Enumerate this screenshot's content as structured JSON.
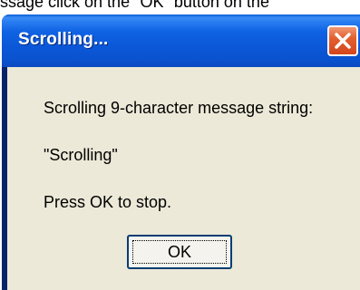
{
  "background": {
    "instruction_text": "ssage click on the \"OK\" button on the"
  },
  "dialog": {
    "title": "Scrolling...",
    "close_icon": "close-x-icon",
    "line1": "Scrolling 9-character message string:",
    "line2": "\"Scrolling\"",
    "line3": "Press OK to stop.",
    "ok_label": "OK"
  },
  "colors": {
    "titlebar": "#0b58d8",
    "client": "#ece9d8",
    "close_button": "#d4461d"
  }
}
